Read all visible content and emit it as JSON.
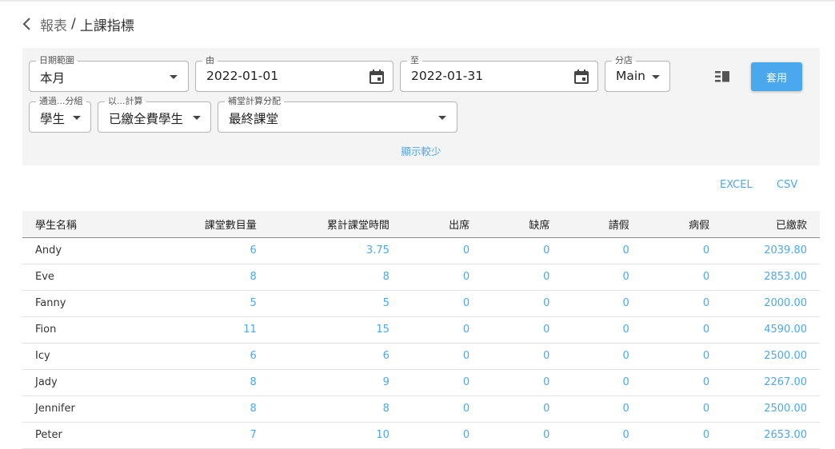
{
  "header": {
    "parent": "報表",
    "separator": "/",
    "title": "上課指標"
  },
  "filters": {
    "date_range": {
      "label": "日期範圍",
      "value": "本月"
    },
    "from": {
      "label": "由",
      "value": "2022-01-01"
    },
    "to": {
      "label": "至",
      "value": "2022-01-31"
    },
    "branch": {
      "label": "分店",
      "value": "Main"
    },
    "group_by": {
      "label": "通過...分組",
      "value": "學生"
    },
    "calc_by": {
      "label": "以...計算",
      "value": "已繳全費學生"
    },
    "makeup_alloc": {
      "label": "補堂計算分配",
      "value": "最終課堂"
    },
    "apply_label": "套用",
    "show_less_label": "顯示較少"
  },
  "export": {
    "excel_label": "EXCEL",
    "csv_label": "CSV"
  },
  "table": {
    "headers": [
      "學生名稱",
      "課堂數目量",
      "累計課堂時間",
      "出席",
      "缺席",
      "請假",
      "病假",
      "已繳款"
    ],
    "rows": [
      [
        "Andy",
        "6",
        "3.75",
        "0",
        "0",
        "0",
        "0",
        "2039.80"
      ],
      [
        "Eve",
        "8",
        "8",
        "0",
        "0",
        "0",
        "0",
        "2853.00"
      ],
      [
        "Fanny",
        "5",
        "5",
        "0",
        "0",
        "0",
        "0",
        "2000.00"
      ],
      [
        "Fion",
        "11",
        "15",
        "0",
        "0",
        "0",
        "0",
        "4590.00"
      ],
      [
        "Icy",
        "6",
        "6",
        "0",
        "0",
        "0",
        "0",
        "2500.00"
      ],
      [
        "Jady",
        "8",
        "9",
        "0",
        "0",
        "0",
        "0",
        "2267.00"
      ],
      [
        "Jennifer",
        "8",
        "8",
        "0",
        "0",
        "0",
        "0",
        "2500.00"
      ],
      [
        "Peter",
        "7",
        "10",
        "0",
        "0",
        "0",
        "0",
        "2653.00"
      ]
    ]
  },
  "colors": {
    "accent": "#4ba8ef",
    "panel_bg": "#f4f4f4"
  }
}
